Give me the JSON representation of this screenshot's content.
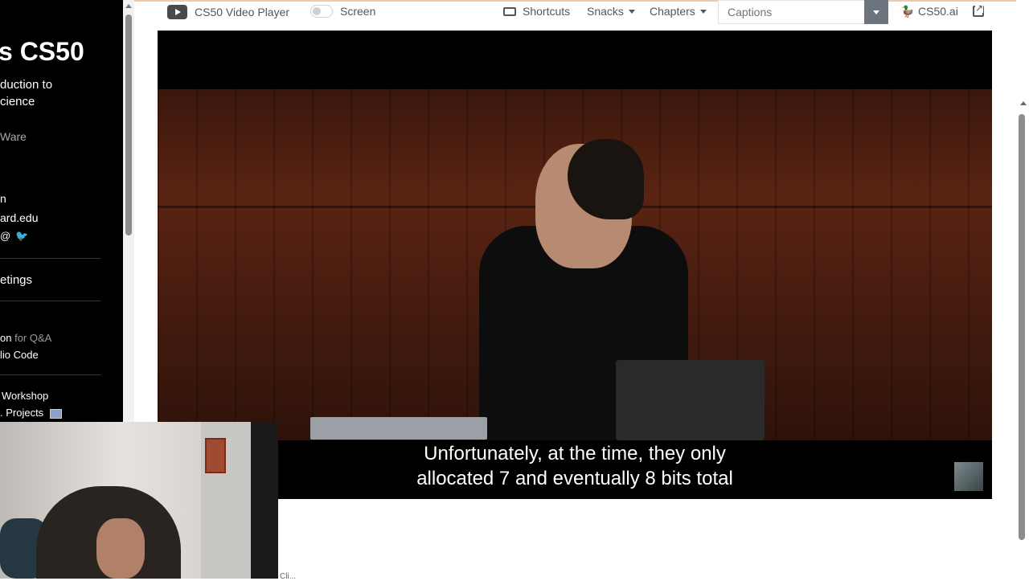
{
  "sidebar": {
    "title": "s CS50",
    "subtitle_line1": "duction to",
    "subtitle_line2": "cience",
    "instructor": "Ware",
    "contact_name": "n",
    "email": "ard.edu",
    "social_icons": [
      "threads-icon",
      "twitter-icon"
    ],
    "meetings": "etings",
    "qa_prefix": "on",
    "qa_suffix": " for Q&A",
    "vscode": "lio Code",
    "workshop": "Workshop",
    "projects": ". Projects"
  },
  "toolbar": {
    "player_label": "CS50 Video Player",
    "screen_label": "Screen",
    "shortcuts_label": "Shortcuts",
    "snacks_label": "Snacks",
    "chapters_label": "Chapters",
    "captions_placeholder": "Captions",
    "cs50ai_label": "CS50.ai"
  },
  "video": {
    "subtitle_line1": "Unfortunately, at the time, they only",
    "subtitle_line2": "allocated 7 and eventually 8 bits total"
  },
  "page": {
    "peek_text": "Cli..."
  },
  "colors": {
    "sidebar_bg": "#000000",
    "captions_button": "#6c757d",
    "accent_bar": "#f1c9a9"
  }
}
